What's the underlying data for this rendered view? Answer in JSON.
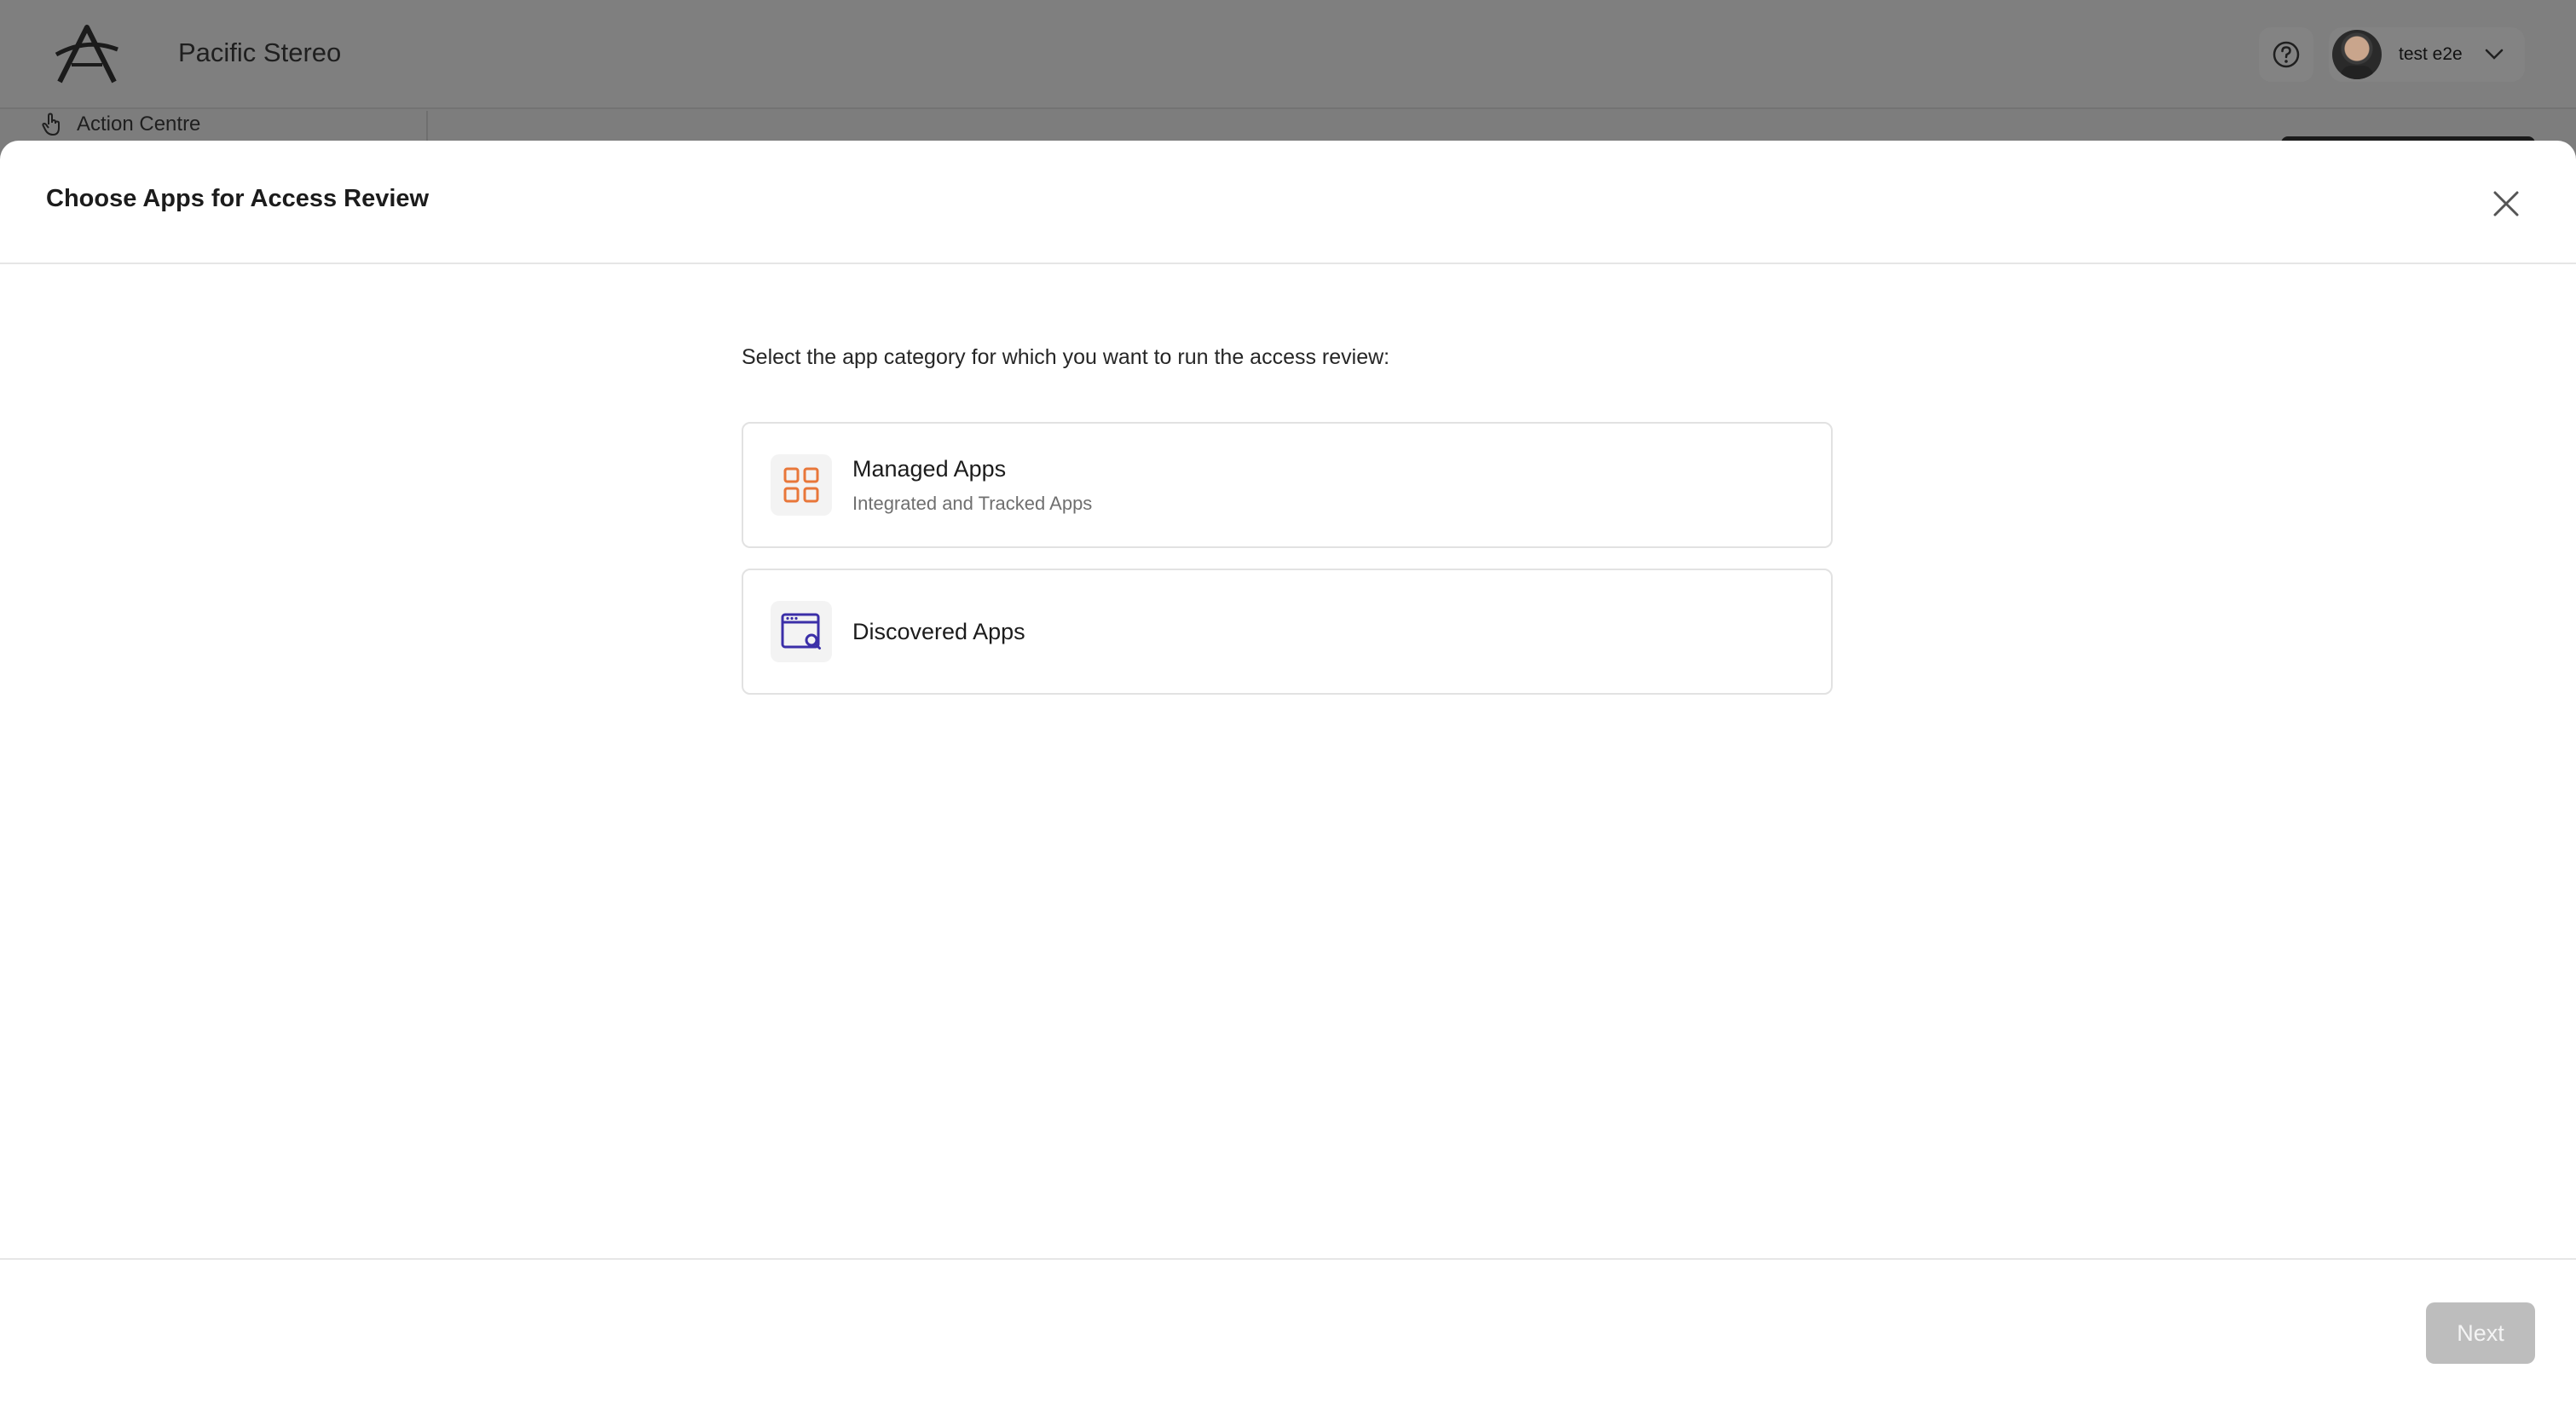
{
  "app": {
    "org_name": "Pacific Stereo",
    "user_name": "test e2e",
    "nav_item": "Action Centre"
  },
  "modal": {
    "title": "Choose Apps for Access Review",
    "instruction": "Select the app category for which you want to run the access review:",
    "options": [
      {
        "title": "Managed Apps",
        "subtitle": "Integrated and Tracked Apps",
        "icon": "grid-icon",
        "icon_color": "#e8773a"
      },
      {
        "title": "Discovered Apps",
        "icon": "browser-search-icon",
        "icon_color": "#3b2fa8"
      }
    ],
    "next_label": "Next"
  },
  "colors": {
    "overlay": "#7d7d7d",
    "disabled_button": "#bdbdbd"
  }
}
